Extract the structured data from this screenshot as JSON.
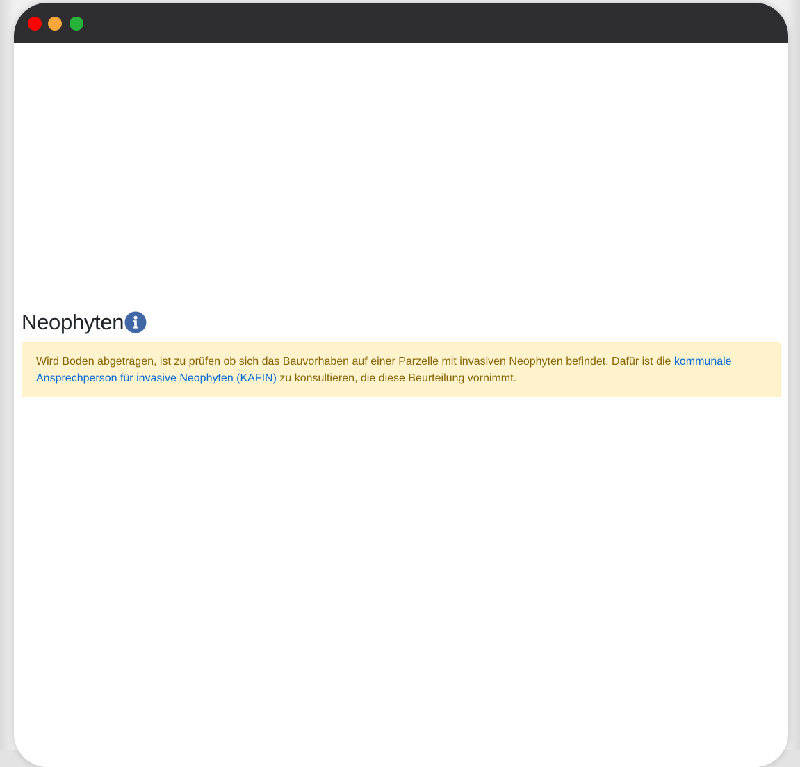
{
  "window": {
    "controls": {
      "close": "close-button",
      "minimize": "minimize-button",
      "maximize": "maximize-button"
    }
  },
  "section": {
    "title": "Neophyten",
    "info_icon": "info-circle-icon",
    "alert": {
      "text_before": "Wird Boden abgetragen, ist zu prüfen ob sich das Bauvorhaben auf einer Parzelle mit invasiven Neophyten befindet. Dafür ist die ",
      "link_text": "kommunale Ansprechperson für invasive Neophyten (KAFIN)",
      "text_after": " zu konsultieren, die diese Beurteilung vornimmt."
    }
  },
  "colors": {
    "titlebar": "#2e2e30",
    "close": "#fe0000",
    "minimize": "#f9a73a",
    "maximize": "#27b23b",
    "alert_background": "#fff3cd",
    "alert_text": "#856404",
    "link": "#0069d9",
    "info_icon": "#3f67a6"
  }
}
